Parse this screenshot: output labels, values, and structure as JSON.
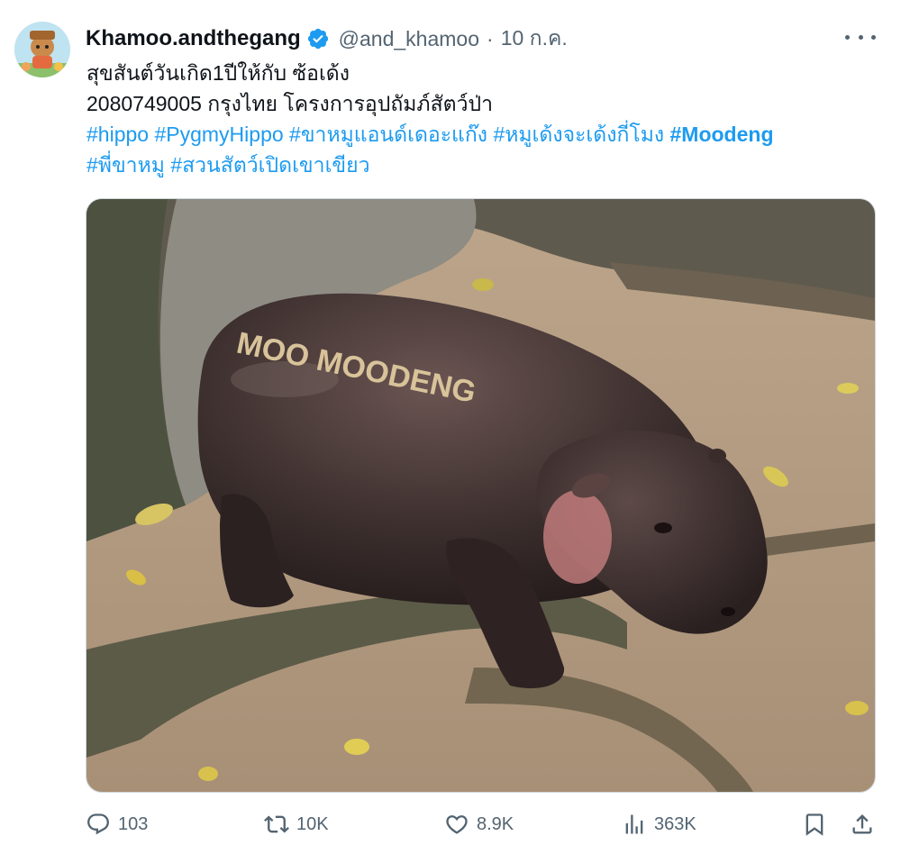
{
  "tweet": {
    "author_name": "Khamoo.andthegang",
    "handle": "@and_khamoo",
    "separator": "·",
    "time": "10 ก.ค.",
    "lines": [
      "สุขสันต์วันเกิด1ปีให้กับ ซ้อเด้ง",
      "2080749005 กรุงไทย โครงการอุปถัมภ์สัตว์ป่า"
    ],
    "hashtags_line1": [
      "#hippo",
      "#PygmyHippo",
      "#ขาหมูแอนด์เดอะแก๊ง",
      "#หมูเด้งจะเด้งกี่โมง",
      "#Moodeng"
    ],
    "hashtags_line2": [
      "#พี่ขาหมู",
      "#สวนสัตว์เปิดเขาเขียว"
    ],
    "image_text": "MOO MOODENG"
  },
  "actions": {
    "replies": "103",
    "reposts": "10K",
    "likes": "8.9K",
    "views": "363K"
  },
  "colors": {
    "link": "#1d9bf0",
    "secondary": "#536471",
    "verified": "#1d9bf0"
  },
  "icons": [
    "avatar",
    "verified-badge-icon",
    "more-icon",
    "reply-icon",
    "repost-icon",
    "like-icon",
    "views-icon",
    "bookmark-icon",
    "share-icon"
  ]
}
